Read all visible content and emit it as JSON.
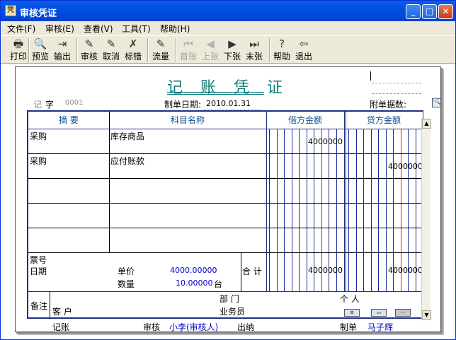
{
  "window": {
    "title": "审核凭证",
    "icon": "app-icon"
  },
  "menu": [
    "文件(F)",
    "审核(E)",
    "查看(V)",
    "工具(T)",
    "帮助(H)"
  ],
  "toolbar": [
    {
      "label": "打印",
      "icon": "printer-icon",
      "enabled": true
    },
    {
      "label": "预览",
      "icon": "preview-icon",
      "enabled": true
    },
    {
      "label": "输出",
      "icon": "export-icon",
      "enabled": true
    },
    {
      "label": "审核",
      "icon": "audit-icon",
      "enabled": true
    },
    {
      "label": "取消",
      "icon": "cancel-icon",
      "enabled": true
    },
    {
      "label": "标错",
      "icon": "mark-error-icon",
      "enabled": true
    },
    {
      "label": "流量",
      "icon": "cashflow-icon",
      "enabled": true
    },
    {
      "label": "首张",
      "icon": "first-icon",
      "enabled": false
    },
    {
      "label": "上张",
      "icon": "prev-icon",
      "enabled": false
    },
    {
      "label": "下张",
      "icon": "next-icon",
      "enabled": true
    },
    {
      "label": "末张",
      "icon": "last-icon",
      "enabled": true
    },
    {
      "label": "帮助",
      "icon": "help-icon",
      "enabled": true
    },
    {
      "label": "退出",
      "icon": "exit-icon",
      "enabled": true
    }
  ],
  "voucher": {
    "title": "记 账 凭 证",
    "type_label": "记",
    "word_label": "字",
    "number": "0001",
    "date_label": "制单日期:",
    "date": "2010.01.31",
    "attachments_label": "附单据数:",
    "headers": {
      "summary": "摘 要",
      "account": "科目名称",
      "debit": "借方金额",
      "credit": "贷方金额"
    },
    "rows": [
      {
        "summary": "采购",
        "account": "库存商品",
        "debit": "4000000",
        "credit": ""
      },
      {
        "summary": "采购",
        "account": "应付账款",
        "debit": "",
        "credit": "4000000"
      },
      {
        "summary": "",
        "account": "",
        "debit": "",
        "credit": ""
      },
      {
        "summary": "",
        "account": "",
        "debit": "",
        "credit": ""
      },
      {
        "summary": "",
        "account": "",
        "debit": "",
        "credit": ""
      }
    ],
    "footer": {
      "ticket_label": "票号",
      "date_label": "日期",
      "unit_price_label": "单价",
      "unit_price": "4000.00000",
      "qty_label": "数量",
      "qty": "10.00000",
      "unit": "台",
      "total_label": "合 计",
      "total_debit": "4000000",
      "total_credit": "4000000"
    },
    "remarks": {
      "label": "备注",
      "dept_label": "部 门",
      "person_label": "个 人",
      "customer_label": "客 户",
      "salesman_label": "业务员"
    },
    "signatures": {
      "bookkeep_label": "记账",
      "audit_label": "审核",
      "auditor": "小李(审核人)",
      "cashier_label": "出纳",
      "maker_label": "制单",
      "maker": "马子辉"
    }
  },
  "colors": {
    "title": "#0d7a7a",
    "ruleBlue": "#1a2aa0",
    "ruleRed": "#d02020",
    "amount": "#0000c8"
  }
}
